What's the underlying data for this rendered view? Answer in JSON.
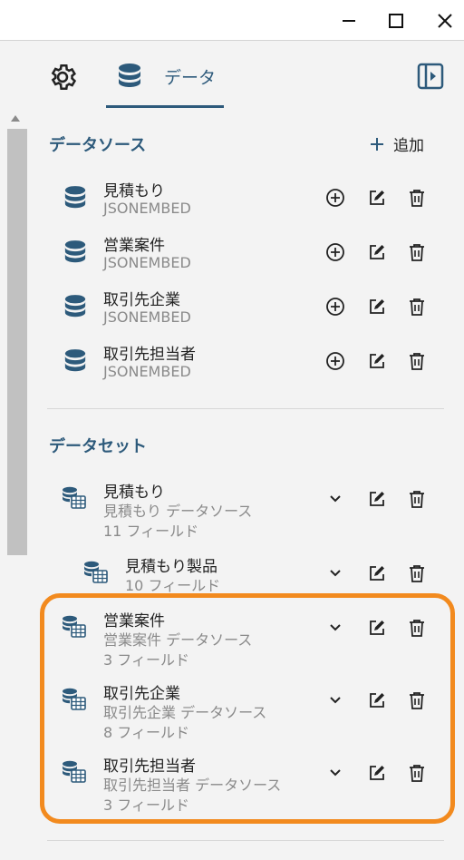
{
  "window": {
    "minimize": "minimize-icon",
    "maximize": "maximize-icon",
    "close": "close-icon"
  },
  "tabs": {
    "settings_icon": "gear-icon",
    "data_label": "データ",
    "data_icon": "database-icon",
    "panel_icon": "panel-toggle-icon"
  },
  "datasources": {
    "title": "データソース",
    "add_label": "追加",
    "items": [
      {
        "name": "見積もり",
        "type": "JSONEMBED"
      },
      {
        "name": "営業案件",
        "type": "JSONEMBED"
      },
      {
        "name": "取引先企業",
        "type": "JSONEMBED"
      },
      {
        "name": "取引先担当者",
        "type": "JSONEMBED"
      }
    ]
  },
  "datasets": {
    "title": "データセット",
    "items": [
      {
        "name": "見積もり",
        "source": "見積もり データソース",
        "fields": "11 フィールド"
      },
      {
        "name": "見積もり製品",
        "fields": "10 フィールド"
      },
      {
        "name": "営業案件",
        "source": "営業案件 データソース",
        "fields": "3 フィールド"
      },
      {
        "name": "取引先企業",
        "source": "取引先企業 データソース",
        "fields": "8 フィールド"
      },
      {
        "name": "取引先担当者",
        "source": "取引先担当者 データソース",
        "fields": "3 フィールド"
      }
    ]
  },
  "colors": {
    "accent": "#2d5a7b",
    "highlight": "#f28a1e"
  }
}
